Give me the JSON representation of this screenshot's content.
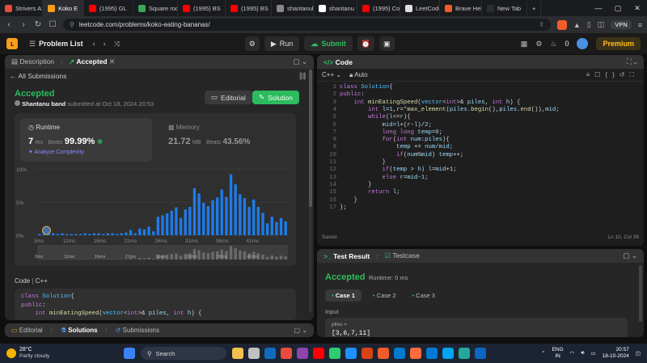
{
  "browser": {
    "tabs": [
      {
        "label": "Strivers A2",
        "color": "#e74c3c"
      },
      {
        "label": "Koko E",
        "color": "#f89f1b",
        "active": true
      },
      {
        "label": "(1995) GL",
        "color": "#ff0000"
      },
      {
        "label": "Square roo",
        "color": "#3ba55d"
      },
      {
        "label": "(1995) BS",
        "color": "#ff0000"
      },
      {
        "label": "(1995) BS",
        "color": "#ff0000"
      },
      {
        "label": "shantanub",
        "color": "#888888"
      },
      {
        "label": "shantanu",
        "color": "#ffffff"
      },
      {
        "label": "(1995) Co",
        "color": "#ff0000"
      },
      {
        "label": "LeetCode",
        "color": "#dddddd"
      },
      {
        "label": "Brave Help",
        "color": "#f25c2a"
      },
      {
        "label": "New Tab",
        "color": "#2c2d31"
      }
    ],
    "url": "leetcode.com/problems/koko-eating-bananas/",
    "vpn": "VPN"
  },
  "lc_header": {
    "problem_list": "Problem List",
    "run": "Run",
    "submit": "Submit",
    "coins": "0",
    "premium": "Premium"
  },
  "left": {
    "tabs": [
      "Description",
      "Accepted"
    ],
    "all_submissions": "All Submissions",
    "status": "Accepted",
    "user": "Shantanu band",
    "submitted_at": "submitted at Oct 18, 2024 20:53",
    "editorial": "Editorial",
    "solution": "Solution",
    "runtime_label": "Runtime",
    "runtime_value": "7",
    "runtime_unit": "ms",
    "beats_label": "Beats",
    "beats_value": "99.99%",
    "analyze": "Analyze Complexity",
    "memory_label": "Memory",
    "memory_value": "21.72",
    "memory_unit": "MB",
    "mem_beats_value": "43.56%",
    "code_label": "Code",
    "lang": "C++",
    "bottom_tabs": [
      "Editorial",
      "Solutions",
      "Submissions"
    ]
  },
  "chart_data": {
    "type": "bar",
    "x_ticks": [
      "3ms",
      "11ms",
      "16ms",
      "21ms",
      "26ms",
      "31ms",
      "36ms",
      "41ms"
    ],
    "y_ticks": [
      "10%",
      "5%",
      "0%"
    ],
    "ylim": [
      0,
      10
    ],
    "values": [
      0.2,
      0.2,
      0.2,
      0.3,
      0.2,
      0.3,
      0.2,
      0.2,
      0.2,
      0.2,
      0.3,
      0.2,
      0.3,
      0.3,
      0.2,
      0.3,
      0.3,
      0.2,
      0.3,
      0.4,
      0.8,
      0.3,
      1.0,
      0.9,
      1.3,
      0.6,
      2.8,
      3.0,
      3.3,
      3.7,
      4.2,
      2.6,
      3.9,
      4.3,
      7.1,
      6.3,
      4.9,
      4.4,
      5.3,
      5.7,
      6.9,
      5.8,
      9.2,
      7.7,
      6.2,
      5.6,
      4.3,
      5.4,
      4.3,
      3.4,
      1.8,
      2.8,
      2.0,
      2.6,
      2.1
    ],
    "highlight_index": 1
  },
  "editor": {
    "title": "Code",
    "lang": "C++",
    "auto": "Auto",
    "saved": "Saved",
    "cursor": "Ln 10, Col 36",
    "lines": [
      "class Solution{",
      "public:",
      "    int minEatingSpeed(vector<int>& piles, int h) {",
      "        int l=1,r=*max_element(piles.begin(),piles.end()),mid;",
      "        while(l<=r){",
      "            mid=l+(r-l)/2;",
      "            long long temp=0;",
      "            for(int num:piles){",
      "                temp += num/mid;",
      "                if(num%mid) temp++;",
      "            }",
      "            if(temp > h) l=mid+1;",
      "            else r=mid-1;",
      "        }",
      "        return l;",
      "    }",
      "};"
    ]
  },
  "left_code": [
    "class Solution{",
    "public:",
    "    int minEatingSpeed(vector<int>& piles, int h) {"
  ],
  "test": {
    "tab1": "Test Result",
    "tab2": "Testcase",
    "status": "Accepted",
    "runtime": "Runtime: 0 ms",
    "cases": [
      "Case 1",
      "Case 2",
      "Case 3"
    ],
    "input_label": "Input",
    "var": "piles =",
    "value": "[3,6,7,11]"
  },
  "taskbar": {
    "temp": "28°C",
    "weather": "Partly cloudy",
    "search": "Search",
    "lang1": "ENG",
    "lang2": "IN",
    "time": "20:57",
    "date": "18-10-2024"
  }
}
